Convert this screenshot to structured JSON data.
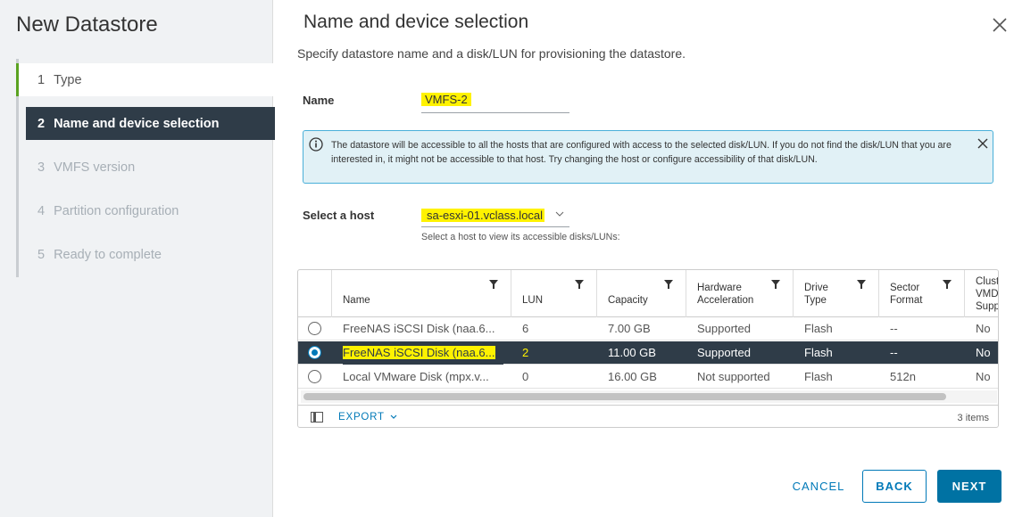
{
  "wizard": {
    "title": "New Datastore",
    "steps": [
      {
        "num": "1",
        "label": "Type"
      },
      {
        "num": "2",
        "label": "Name and device selection"
      },
      {
        "num": "3",
        "label": "VMFS version"
      },
      {
        "num": "4",
        "label": "Partition configuration"
      },
      {
        "num": "5",
        "label": "Ready to complete"
      }
    ]
  },
  "page": {
    "title": "Name and device selection",
    "subtitle": "Specify datastore name and a disk/LUN for provisioning the datastore."
  },
  "form": {
    "name_label": "Name",
    "name_value": "VMFS-2",
    "info_text": "The datastore will be accessible to all the hosts that are configured with access to the selected disk/LUN. If you do not find the disk/LUN that you are interested in, it might not be accessible to that host. Try changing the host or configure accessibility of that disk/LUN.",
    "host_label": "Select a host",
    "host_value": "sa-esxi-01.vclass.local",
    "host_help": "Select a host to view its accessible disks/LUNs:"
  },
  "grid": {
    "columns": [
      "Name",
      "LUN",
      "Capacity",
      "Hardware Acceleration",
      "Drive Type",
      "Sector Format",
      "Clust VMD Supp"
    ],
    "rows": [
      {
        "name": "FreeNAS iSCSI Disk (naa.6...",
        "lun": "6",
        "capacity": "7.00 GB",
        "hw": "Supported",
        "drive": "Flash",
        "sector": "--",
        "cluster": "No",
        "selected": false
      },
      {
        "name": "FreeNAS iSCSI Disk (naa.6...",
        "lun": "2",
        "capacity": "11.00 GB",
        "hw": "Supported",
        "drive": "Flash",
        "sector": "--",
        "cluster": "No",
        "selected": true
      },
      {
        "name": "Local VMware Disk (mpx.v...",
        "lun": "0",
        "capacity": "16.00 GB",
        "hw": "Not supported",
        "drive": "Flash",
        "sector": "512n",
        "cluster": "No",
        "selected": false
      }
    ],
    "export_label": "EXPORT",
    "item_count": "3 items"
  },
  "buttons": {
    "cancel": "CANCEL",
    "back": "BACK",
    "next": "NEXT"
  },
  "colors": {
    "accent": "#0079b8",
    "selected_row": "#2f3c48",
    "highlight": "#fff200",
    "completed_step": "#5aa220"
  },
  "icons": [
    "info-icon",
    "close-icon",
    "filter-icon",
    "chevron-down-icon",
    "column-toggle-icon"
  ]
}
